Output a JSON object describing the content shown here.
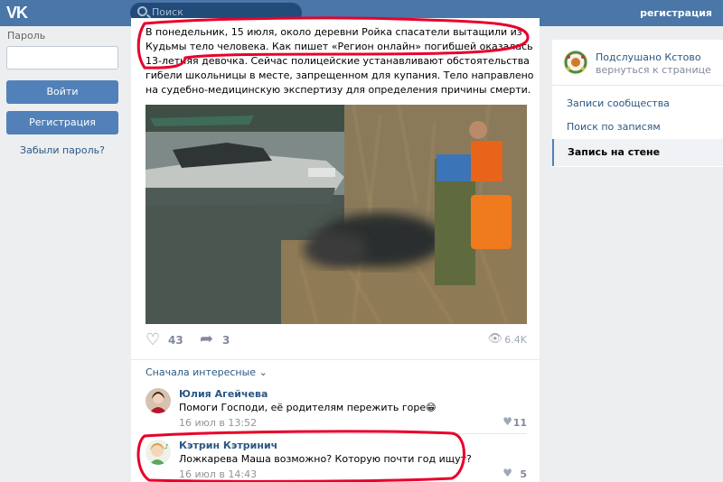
{
  "header": {
    "logo": "VK",
    "search_placeholder": "Поиск",
    "register_link": "регистрация"
  },
  "login": {
    "password_label": "Пароль",
    "login_button": "Войти",
    "register_button": "Регистрация",
    "forgot_link": "Забыли пароль?"
  },
  "post": {
    "text": "В понедельник, 15 июля, около деревни Ройка спасатели вытащили из Кудьмы тело человека. Как пишет «Регион онлайн» погибшей оказалась 13-летняя девочка. Сейчас полицейские устанавливают обстоятельства гибели школьницы в месте, запрещенном для купания. Тело направлено на судебно-медицинскую экспертизу для определения причины смерти.",
    "likes": "43",
    "shares": "3",
    "views": "6.4K",
    "sort_label": "Сначала интересные"
  },
  "comments": [
    {
      "name": "Юлия Агейчева",
      "text": "Помоги Господи, её родителям пережить горе😁",
      "time": "16 июл в 13:52",
      "likes": "11"
    },
    {
      "name": "Кэтрин Кэтринич",
      "text": "Ложкарева Маша возможно? Которую почти год ищут?",
      "time": "16 июл в 14:43",
      "likes": "5"
    }
  ],
  "sidebar": {
    "group_name": "Подслушано Кстово",
    "back_link": "вернуться к странице",
    "items": [
      {
        "label": "Записи сообщества"
      },
      {
        "label": "Поиск по записям"
      },
      {
        "label": "Запись на стене"
      }
    ]
  },
  "colors": {
    "header_bg": "#4a76a8",
    "button_bg": "#5181b8",
    "link": "#2a5885",
    "annotation": "#e8002a"
  }
}
